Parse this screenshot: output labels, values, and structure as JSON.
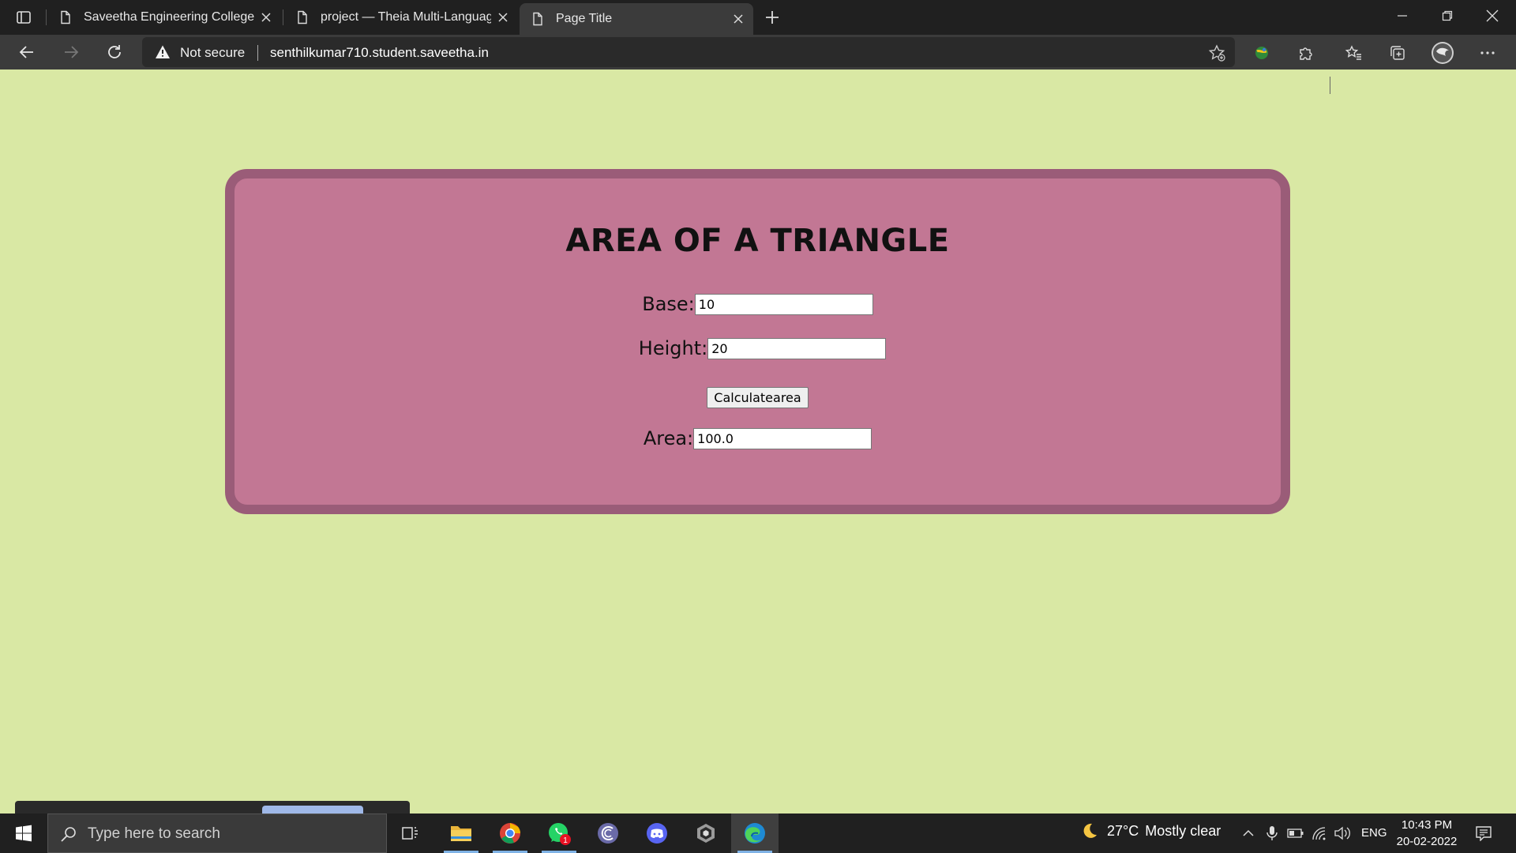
{
  "browser": {
    "tabs": [
      {
        "label": "Saveetha Engineering College",
        "active": false
      },
      {
        "label": "project — Theia Multi-Language",
        "active": false
      },
      {
        "label": "Page Title",
        "active": true
      }
    ],
    "address": {
      "security_label": "Not secure",
      "url": "senthilkumar710.student.saveetha.in"
    }
  },
  "page": {
    "title": "AREA OF A TRIANGLE",
    "base_label": "Base:",
    "base_value": "10",
    "height_label": "Height:",
    "height_value": "20",
    "button_label": "Calculatearea",
    "area_label": "Area:",
    "area_value": "100.0",
    "colors": {
      "background": "#d9e8a4",
      "card": "#c27794",
      "card_border": "#9a5c78"
    }
  },
  "taskbar": {
    "search_placeholder": "Type here to search",
    "weather": {
      "temp": "27°C",
      "condition": "Mostly clear"
    },
    "language": "ENG",
    "time": "10:43 PM",
    "date": "20-02-2022",
    "whatsapp_badge": "1"
  }
}
